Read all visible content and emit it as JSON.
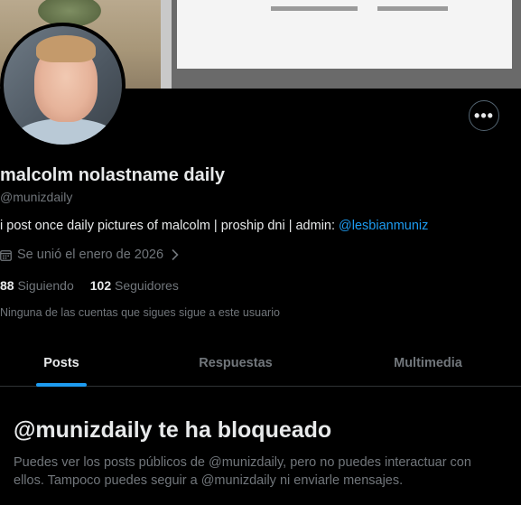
{
  "profile": {
    "display_name": "malcolm nolastname daily",
    "handle": "@munizdaily",
    "bio_text": "i post once daily pictures of malcolm | proship dni | admin: ",
    "bio_link": "@lesbianmuniz",
    "joined": "Se unió el enero de 2026",
    "following_count": "88",
    "following_label": "Siguiendo",
    "followers_count": "102",
    "followers_label": "Seguidores",
    "not_followed_note": "Ninguna de las cuentas que sigues sigue a este usuario",
    "more_button_glyph": "•••"
  },
  "tabs": [
    {
      "label": "Posts",
      "active": true
    },
    {
      "label": "Respuestas",
      "active": false
    },
    {
      "label": "Multimedia",
      "active": false
    }
  ],
  "blocked": {
    "title": "@munizdaily te ha bloqueado",
    "description": "Puedes ver los posts públicos de @munizdaily, pero no puedes interactuar con ellos. Tampoco puedes seguir a @munizdaily ni enviarle mensajes."
  },
  "icons": {
    "calendar": "calendar-icon",
    "chevron": "chevron-right-icon",
    "more": "more-horizontal-icon"
  },
  "colors": {
    "background": "#000000",
    "text_primary": "#e7e9ea",
    "text_secondary": "#71767b",
    "accent": "#1d9bf0",
    "border": "#2f3336"
  }
}
